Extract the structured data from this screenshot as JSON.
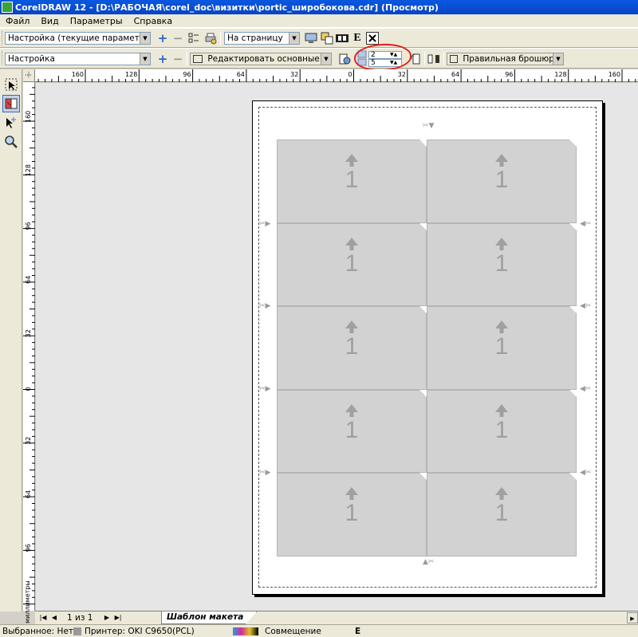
{
  "window": {
    "title": "CorelDRAW 12 - [D:\\РАБОЧАЯ\\corel_doc\\визитки\\portic_широбокова.cdr] (Просмотр)"
  },
  "menu": [
    "Файл",
    "Вид",
    "Параметры",
    "Справка"
  ],
  "toolbar1": {
    "preset_value": "Настройка (текущие параметры не с...",
    "zoom_value": "На страницу",
    "e_label": "E"
  },
  "toolbar2": {
    "preset_value": "Настройка",
    "edit_mode_value": "Редактировать основные параметр",
    "columns_value": "2",
    "rows_value": "5",
    "binding_value": "Правильная брошюровка"
  },
  "rulers": {
    "horizontal_ticks": [
      "160",
      "128",
      "96",
      "64",
      "32",
      "0",
      "32",
      "64",
      "96",
      "128",
      "160"
    ],
    "vertical_ticks": [
      "160",
      "128",
      "96",
      "64",
      "32",
      "0",
      "32",
      "64",
      "96"
    ],
    "units": "миллиметры"
  },
  "layout": {
    "cell_number": "1"
  },
  "page_nav": {
    "page_indicator": "1 из 1",
    "tab_label": "Шаблон макета"
  },
  "status": {
    "selected": "Выбранное: Нет",
    "printer": "Принтер: OKI C9650(PCL)",
    "match": "Совмещение",
    "e_label": "E"
  }
}
